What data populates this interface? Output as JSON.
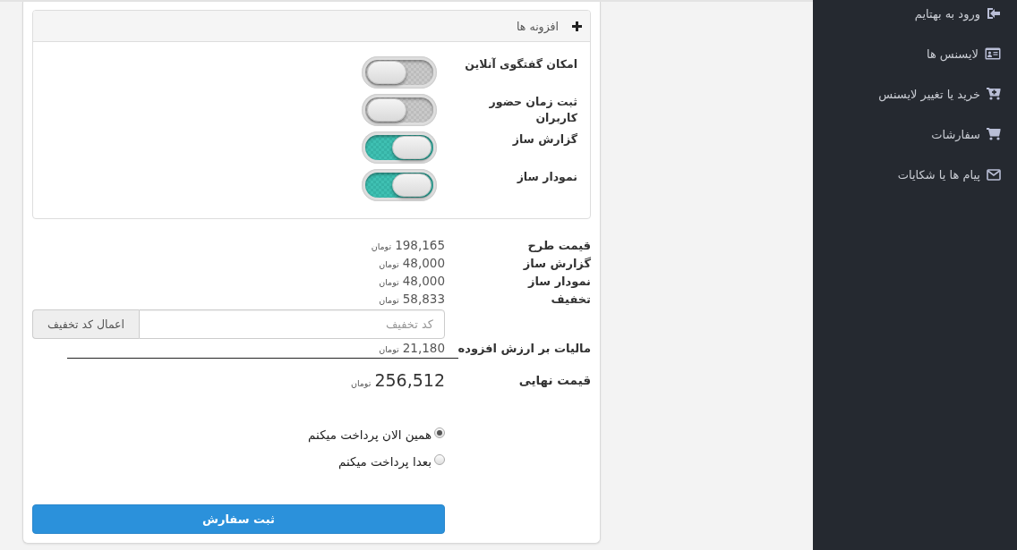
{
  "addons_panel": {
    "title": "افزونه ها",
    "items": [
      {
        "label": "امکان گفتگوی آنلاین",
        "on": false
      },
      {
        "label": "ثبت زمان حضور کاربران",
        "on": false
      },
      {
        "label": "گزارش ساز",
        "on": true
      },
      {
        "label": "نمودار ساز",
        "on": true
      }
    ]
  },
  "price_summary": {
    "rows": [
      {
        "label": "قیمت طرح",
        "amount": "198,165",
        "currency": "تومان"
      },
      {
        "label": "گزارش ساز",
        "amount": "48,000",
        "currency": "تومان"
      },
      {
        "label": "نمودار ساز",
        "amount": "48,000",
        "currency": "تومان"
      },
      {
        "label": "تخفیف",
        "amount": "58,833",
        "currency": "تومان"
      }
    ],
    "discount_code": {
      "placeholder": "کد تخفیف",
      "button": "اعمال کد تخفیف"
    },
    "tax": {
      "label": "مالیات بر ارزش افزوده",
      "amount": "21,180",
      "currency": "تومان"
    },
    "total": {
      "label": "قیمت نهایی",
      "amount": "256,512",
      "currency": "تومان"
    }
  },
  "payment_options": [
    {
      "label": "همین الان پرداخت میکنم",
      "selected": true
    },
    {
      "label": "بعدا پرداخت میکنم",
      "selected": false
    }
  ],
  "submit_button": {
    "label": "ثبت سفارش"
  },
  "sidebar": {
    "items": [
      {
        "label": "ورود به بهتایم"
      },
      {
        "label": "لایسنس ها"
      },
      {
        "label": "خرید یا تغییر لایسنس"
      },
      {
        "label": "سفارشات"
      },
      {
        "label": "پیام ها یا شکایات"
      }
    ]
  }
}
